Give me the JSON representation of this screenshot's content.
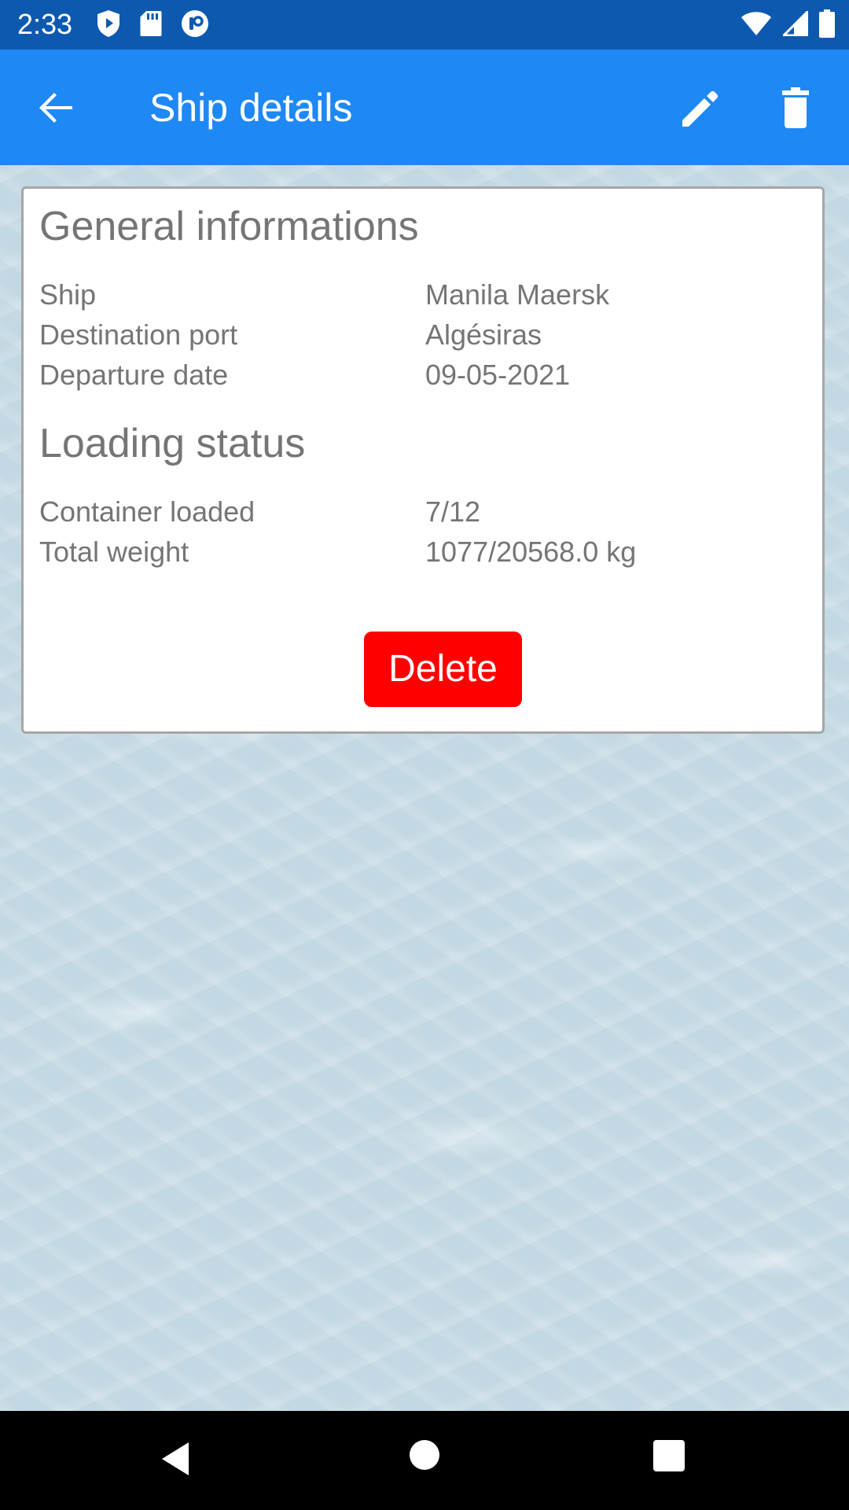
{
  "status_bar": {
    "time": "2:33",
    "left_icons": [
      "shield-play-icon",
      "sd-card-icon",
      "app-notification-icon"
    ],
    "right_icons": [
      "wifi-icon",
      "cellular-signal-icon",
      "battery-icon"
    ]
  },
  "app_bar": {
    "title": "Ship details",
    "back_icon": "arrow-left-icon",
    "actions": [
      "pencil-icon",
      "trash-icon"
    ]
  },
  "general": {
    "title": "General informations",
    "rows": [
      {
        "label": "Ship",
        "value": "Manila Maersk"
      },
      {
        "label": "Destination port",
        "value": "Algésiras"
      },
      {
        "label": "Departure date",
        "value": "09-05-2021"
      }
    ]
  },
  "loading": {
    "title": "Loading status",
    "rows": [
      {
        "label": "Container loaded",
        "value": "7/12"
      },
      {
        "label": "Total weight",
        "value": "1077/20568.0 kg"
      }
    ]
  },
  "actions": {
    "delete_label": "Delete"
  },
  "colors": {
    "status_bar": "#0d59b0",
    "app_bar": "#1e88f5",
    "delete_button": "#ff0000",
    "text_gray": "#757575"
  },
  "nav_bar": {
    "buttons": [
      "nav-back-icon",
      "nav-home-icon",
      "nav-recents-icon"
    ]
  }
}
